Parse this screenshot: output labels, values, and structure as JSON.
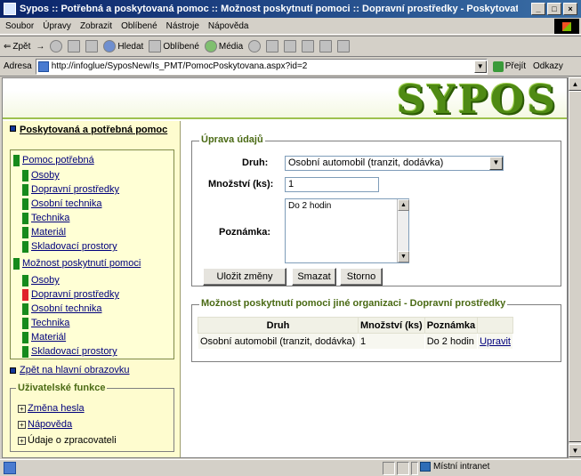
{
  "window": {
    "title": "Sypos :: Potřebná a poskytovaná pomoc :: Možnost poskytnutí pomoci :: Dopravní prostředky - Poskytovatel aplikace Microsoft Int",
    "min": "_",
    "max": "□",
    "close": "×"
  },
  "menu": [
    "Soubor",
    "Úpravy",
    "Zobrazit",
    "Oblíbené",
    "Nástroje",
    "Nápověda"
  ],
  "toolbar": {
    "back": "Zpět",
    "search": "Hledat",
    "favorites": "Oblíbené",
    "media": "Média"
  },
  "address": {
    "label": "Adresa",
    "url": "http://infoglue/SyposNew/Is_PMT/PomocPoskytovana.aspx?id=2",
    "go": "Přejít",
    "links": "Odkazy"
  },
  "banner": {
    "logo": "SYPOS"
  },
  "leftnav": {
    "section_title": "Poskytovaná a potřebná pomoc",
    "items": [
      {
        "label": "Pomoc potřebná",
        "level": 0,
        "active": false
      },
      {
        "label": "Osoby",
        "level": 1,
        "active": false
      },
      {
        "label": "Dopravní prostředky",
        "level": 1,
        "active": false
      },
      {
        "label": "Osobní technika",
        "level": 1,
        "active": false
      },
      {
        "label": "Technika",
        "level": 1,
        "active": false
      },
      {
        "label": "Materiál",
        "level": 1,
        "active": false
      },
      {
        "label": "Skladovací prostory",
        "level": 1,
        "active": false
      },
      {
        "label": "Možnost poskytnutí pomoci",
        "level": 0,
        "active": false
      },
      {
        "label": "Osoby",
        "level": 1,
        "active": false
      },
      {
        "label": "Dopravní prostředky",
        "level": 1,
        "active": true
      },
      {
        "label": "Osobní technika",
        "level": 1,
        "active": false
      },
      {
        "label": "Technika",
        "level": 1,
        "active": false
      },
      {
        "label": "Materiál",
        "level": 1,
        "active": false
      },
      {
        "label": "Skladovací prostory",
        "level": 1,
        "active": false
      }
    ],
    "back_link": "Zpět na hlavní obrazovku"
  },
  "user_functions": {
    "legend": "Uživatelské funkce",
    "items": [
      {
        "label": "Změna hesla",
        "link": true
      },
      {
        "label": "Nápověda",
        "link": true
      },
      {
        "label": "Údaje o zpracovateli",
        "link": false
      }
    ]
  },
  "edit_form": {
    "legend": "Úprava údajů",
    "druh_label": "Druh:",
    "druh_value": "Osobní automobil (tranzit, dodávka)",
    "mnozstvi_label": "Množství (ks):",
    "mnozstvi_value": "1",
    "poznamka_label": "Poznámka:",
    "poznamka_value": "Do 2 hodin",
    "save_label": "Uložit změny",
    "delete_label": "Smazat",
    "cancel_label": "Storno"
  },
  "offers": {
    "legend": "Možnost poskytnutí pomoci jiné organizaci - Dopravní prostředky",
    "columns": [
      "Druh",
      "Množství (ks)",
      "Poznámka",
      ""
    ],
    "rows": [
      {
        "druh": "Osobní automobil (tranzit, dodávka)",
        "mnozstvi": "1",
        "poznamka": "Do 2 hodin",
        "action": "Upravit"
      }
    ]
  },
  "status": {
    "zone": "Místní intranet"
  },
  "colors": {
    "accent_green": "#168a1c",
    "active_red": "#e0202a",
    "link": "#00007c",
    "panel_bg": "#fefccf"
  }
}
